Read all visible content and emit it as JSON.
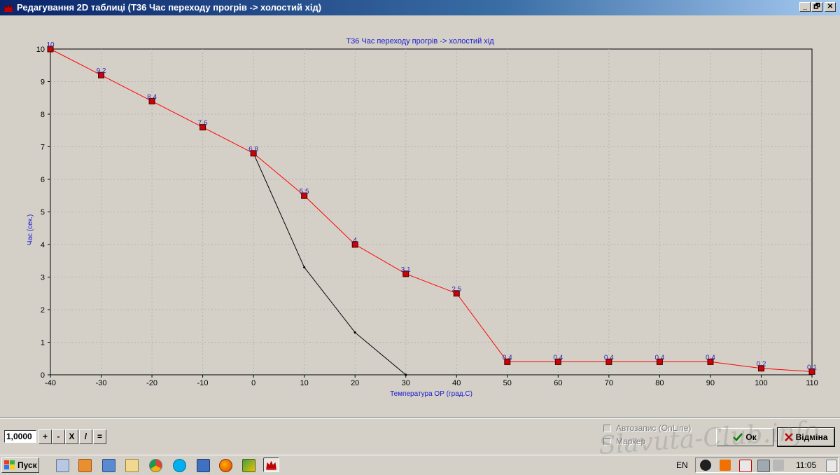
{
  "window": {
    "title": "Редагування 2D таблиці (Т36 Час переходу прогрів -> холостий хід)",
    "buttons": [
      "_",
      "🗗",
      "✕"
    ]
  },
  "chart_data": {
    "type": "line",
    "title": "Т36 Час переходу прогрів -> холостий хід",
    "xlabel": "Температура ОР (град.С)",
    "ylabel": "Час (сек.)",
    "x": [
      -40,
      -30,
      -20,
      -10,
      0,
      10,
      20,
      30,
      40,
      50,
      60,
      70,
      80,
      90,
      100,
      110
    ],
    "xlim": [
      -40,
      110
    ],
    "ylim": [
      0,
      10
    ],
    "xticks": [
      -40,
      -30,
      -20,
      -10,
      0,
      10,
      20,
      30,
      40,
      50,
      60,
      70,
      80,
      90,
      100,
      110
    ],
    "yticks": [
      0,
      1,
      2,
      3,
      4,
      5,
      6,
      7,
      8,
      9,
      10
    ],
    "grid": true,
    "series": [
      {
        "color": "#ff0000",
        "marker": "square",
        "values": [
          10,
          9.2,
          8.4,
          7.6,
          6.8,
          5.5,
          4,
          3.1,
          2.5,
          0.4,
          0.4,
          0.4,
          0.4,
          0.4,
          0.2,
          0.1
        ],
        "labels": [
          "10",
          "9.2",
          "8.4",
          "7.6",
          "6.8",
          "5.5",
          "4",
          "3.1",
          "2.5",
          "0.4",
          "0.4",
          "0.4",
          "0.4",
          "0.4",
          "0.2",
          "0.1"
        ]
      },
      {
        "color": "#000000",
        "marker": "dot",
        "x": [
          0,
          10,
          20,
          30
        ],
        "values": [
          6.8,
          3.3,
          1.3,
          0
        ]
      }
    ]
  },
  "controls": {
    "multiplier_value": "1,0000",
    "calc_buttons": [
      "+",
      "-",
      "X",
      "/",
      "="
    ],
    "autosave_label": "Автозапис (OnLine)",
    "marker_label": "Маркер",
    "ok_label": "Ок",
    "cancel_label": "Відміна"
  },
  "taskbar": {
    "start_label": "Пуск",
    "language": "EN",
    "clock": "11:05"
  },
  "watermark": "Slavuta-Club.info"
}
